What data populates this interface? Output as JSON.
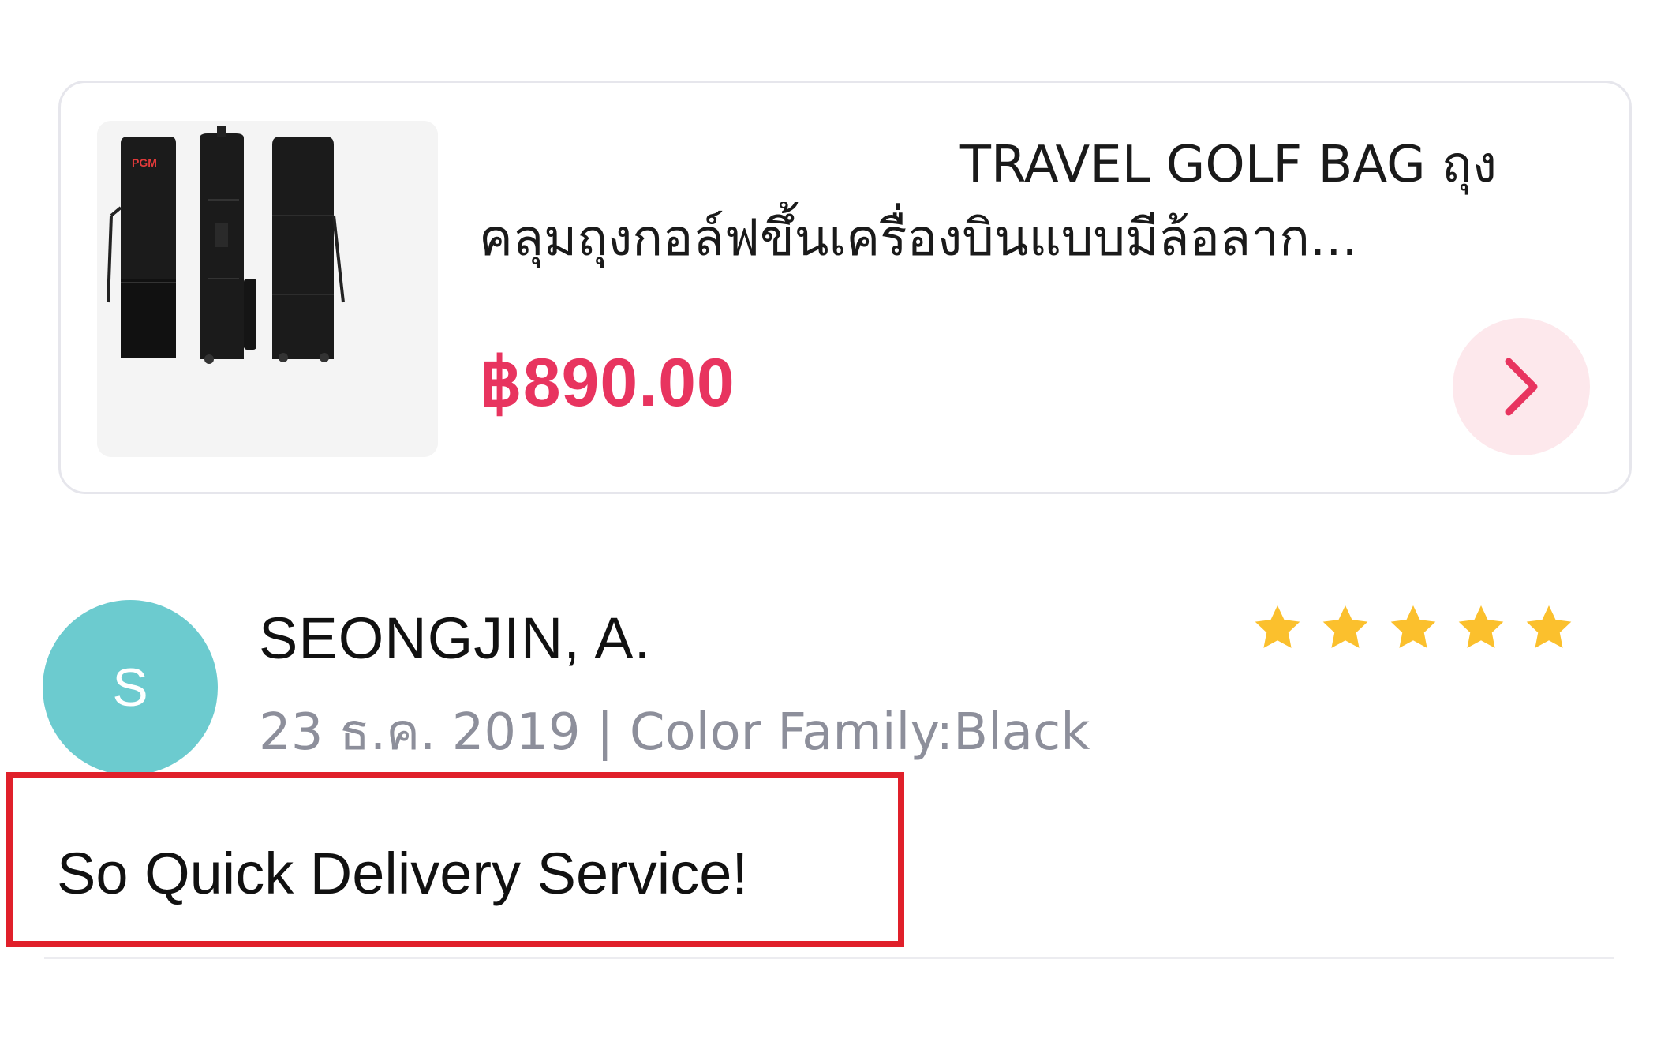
{
  "product": {
    "title_line1": "TRAVEL GOLF BAG ถุง",
    "title_line2": "คลุมถุงกอล์ฟขึ้นเครื่องบินแบบมีล้อลาก...",
    "price": "฿890.00",
    "price_color": "#e8345f",
    "image_brand_text": "PGM",
    "open_icon": "chevron-right-icon"
  },
  "review": {
    "avatar_initial": "S",
    "avatar_color": "#6ccbcf",
    "reviewer_name": "SEONGJIN, A.",
    "meta": "23 ธ.ค. 2019 | Color Family:Black",
    "rating": 5,
    "rating_max": 5,
    "star_color": "#fbc02d",
    "text": "So Quick Delivery Service!",
    "highlight_color": "#e0202a"
  }
}
